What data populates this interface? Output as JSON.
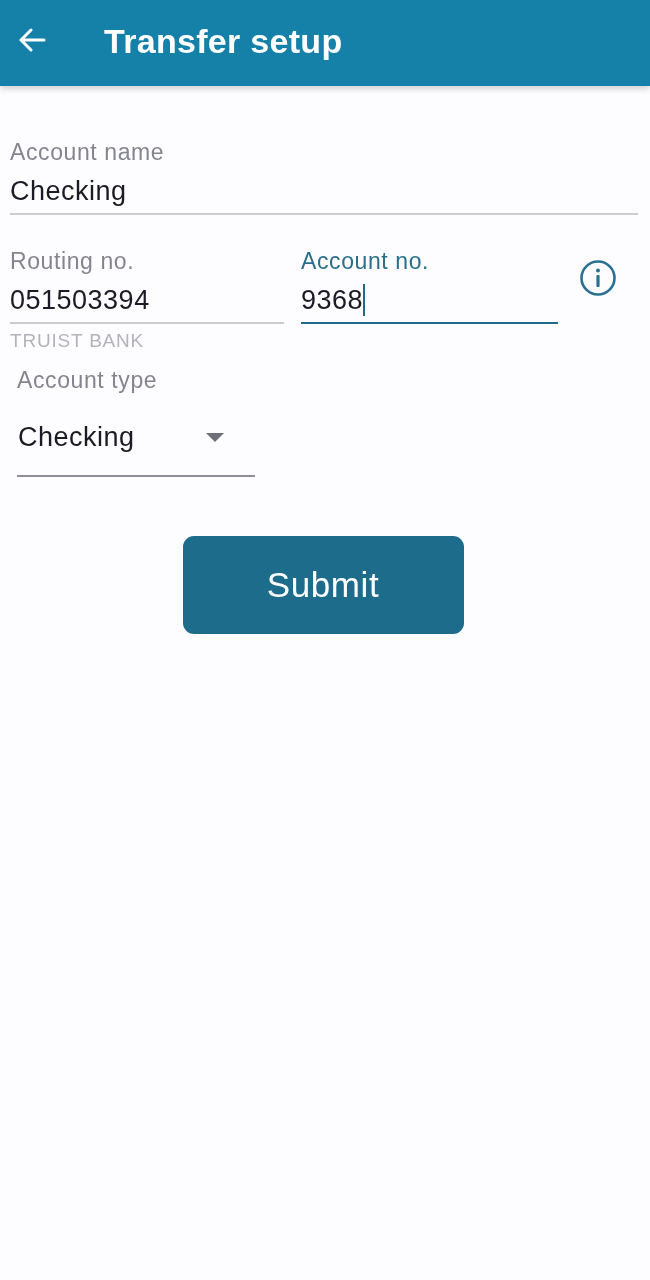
{
  "app_bar": {
    "title": "Transfer setup"
  },
  "account_name": {
    "label": "Account name",
    "value": "Checking",
    "focused": false
  },
  "routing_number": {
    "label": "Routing no.",
    "value": "051503394",
    "helper": "TRUIST BANK",
    "focused": false
  },
  "account_number": {
    "label": "Account no.",
    "value": "9368",
    "focused": true
  },
  "account_type": {
    "label": "Account type",
    "value": "Checking"
  },
  "submit_button": {
    "label": "Submit"
  }
}
